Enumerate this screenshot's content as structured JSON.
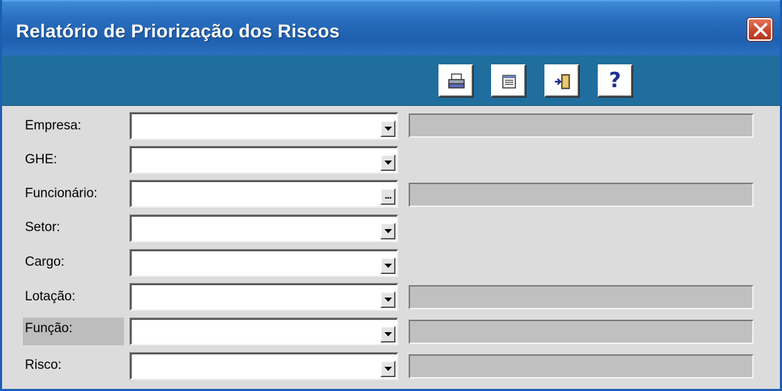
{
  "window": {
    "title": "Relatório de Priorização dos Riscos"
  },
  "toolbar": {
    "buttons": [
      {
        "icon": "printer-icon"
      },
      {
        "icon": "preview-icon"
      },
      {
        "icon": "exit-door-icon"
      },
      {
        "icon": "help-icon",
        "label": "?"
      }
    ]
  },
  "form": {
    "fields": [
      {
        "label": "Empresa:",
        "value": "",
        "button": "dropdown",
        "description": ""
      },
      {
        "label": "GHE:",
        "value": "",
        "button": "dropdown"
      },
      {
        "label": "Funcionário:",
        "value": "",
        "button": "ellipsis",
        "button_label": "...",
        "description": ""
      },
      {
        "label": "Setor:",
        "value": "",
        "button": "dropdown"
      },
      {
        "label": "Cargo:",
        "value": "",
        "button": "dropdown"
      },
      {
        "label": "Lotação:",
        "value": "",
        "button": "dropdown",
        "description": ""
      },
      {
        "label": "Função:",
        "value": "",
        "button": "dropdown",
        "description": ""
      },
      {
        "label": "Risco:",
        "value": "",
        "button": "dropdown",
        "description": ""
      }
    ]
  },
  "colors": {
    "titlebar": "#2a6fc0",
    "toolbar": "#1f6e9e",
    "form_bg": "#dcdcdc",
    "close_button": "#c8442a"
  }
}
